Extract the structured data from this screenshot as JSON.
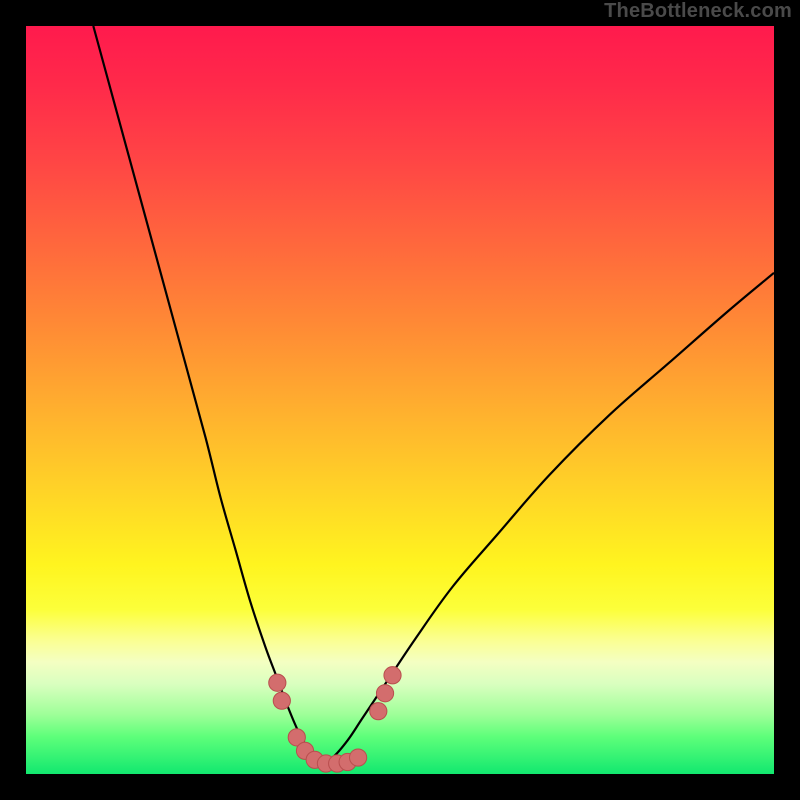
{
  "watermark": "TheBottleneck.com",
  "colors": {
    "frame": "#000000",
    "gradient_top": "#ff1a4d",
    "gradient_bottom": "#12e86f",
    "curve": "#000000",
    "marker_fill": "#d36d6d",
    "marker_stroke": "#b94e4e"
  },
  "chart_data": {
    "type": "line",
    "title": "",
    "xlabel": "",
    "ylabel": "",
    "xlim": [
      0,
      100
    ],
    "ylim": [
      0,
      100
    ],
    "series": [
      {
        "name": "curve-left",
        "x": [
          9,
          12,
          15,
          18,
          21,
          24,
          26,
          28,
          30,
          32,
          33.5,
          35,
          36.5,
          38,
          39.5
        ],
        "y": [
          100,
          89,
          78,
          67,
          56,
          45,
          37,
          30,
          23,
          17,
          13,
          9,
          5.5,
          3,
          1.4
        ]
      },
      {
        "name": "curve-right",
        "x": [
          39.5,
          41,
          43,
          45,
          48,
          52,
          57,
          63,
          70,
          78,
          86,
          94,
          100
        ],
        "y": [
          1.4,
          2.2,
          4.5,
          7.5,
          12,
          18,
          25,
          32,
          40,
          48,
          55,
          62,
          67
        ]
      }
    ],
    "markers": [
      {
        "x": 33.6,
        "y": 12.2,
        "r": 1.15
      },
      {
        "x": 34.2,
        "y": 9.8,
        "r": 1.15
      },
      {
        "x": 36.2,
        "y": 4.9,
        "r": 1.15
      },
      {
        "x": 37.3,
        "y": 3.1,
        "r": 1.15
      },
      {
        "x": 38.6,
        "y": 1.9,
        "r": 1.15
      },
      {
        "x": 40.1,
        "y": 1.4,
        "r": 1.15
      },
      {
        "x": 41.6,
        "y": 1.4,
        "r": 1.15
      },
      {
        "x": 43.0,
        "y": 1.6,
        "r": 1.15
      },
      {
        "x": 44.4,
        "y": 2.2,
        "r": 1.15
      },
      {
        "x": 47.1,
        "y": 8.4,
        "r": 1.15
      },
      {
        "x": 48.0,
        "y": 10.8,
        "r": 1.15
      },
      {
        "x": 49.0,
        "y": 13.2,
        "r": 1.15
      }
    ]
  }
}
